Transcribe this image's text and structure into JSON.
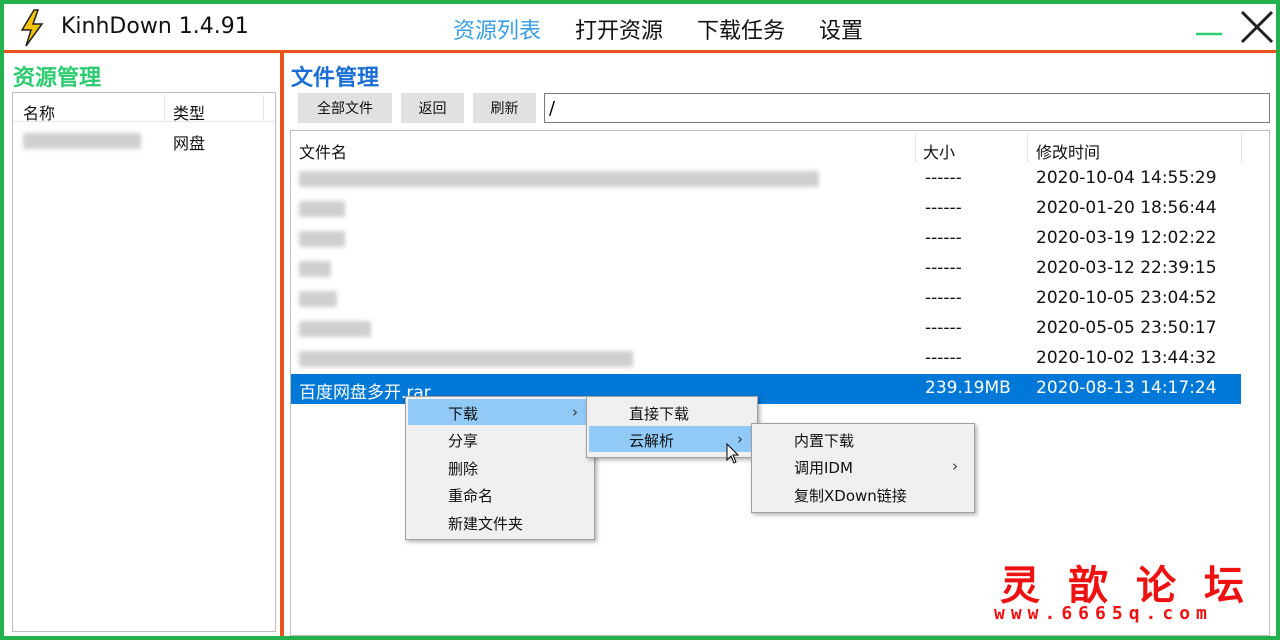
{
  "app": {
    "title": "KinhDown 1.4.91"
  },
  "nav": {
    "tabs": [
      {
        "label": "资源列表"
      },
      {
        "label": "打开资源"
      },
      {
        "label": "下载任务"
      },
      {
        "label": "设置"
      }
    ],
    "active_index": 0
  },
  "colors": {
    "frame": "#22b14c",
    "separator": "#e8541c",
    "left_title": "#2ecc71",
    "right_title": "#1a6fd4",
    "active_tab": "#3a9ee4",
    "selection": "#0078d7",
    "menu_highlight": "#91c9f7",
    "watermark": "#ee1111"
  },
  "left_panel": {
    "title": "资源管理",
    "columns": [
      "名称",
      "类型"
    ],
    "rows": [
      {
        "name": "",
        "type": "网盘"
      }
    ]
  },
  "right_panel": {
    "title": "文件管理",
    "toolbar": {
      "all_files": "全部文件",
      "back": "返回",
      "refresh": "刷新",
      "path": "/"
    },
    "columns": [
      "文件名",
      "大小",
      "修改时间"
    ],
    "files": [
      {
        "name": "",
        "size": "------",
        "time": "2020-10-04 14:55:29"
      },
      {
        "name": "",
        "size": "------",
        "time": "2020-01-20 18:56:44"
      },
      {
        "name": "",
        "size": "------",
        "time": "2020-03-19 12:02:22"
      },
      {
        "name": "",
        "size": "------",
        "time": "2020-03-12 22:39:15"
      },
      {
        "name": "",
        "size": "------",
        "time": "2020-10-05 23:04:52"
      },
      {
        "name": "",
        "size": "------",
        "time": "2020-05-05 23:50:17"
      },
      {
        "name": "",
        "size": "------",
        "time": "2020-10-02 13:44:32"
      },
      {
        "name": "百度网盘多开.rar",
        "size": "239.19MB",
        "time": "2020-08-13 14:17:24"
      }
    ]
  },
  "context_menu": {
    "main": [
      "下载",
      "分享",
      "删除",
      "重命名",
      "新建文件夹"
    ],
    "download_sub": [
      "直接下载",
      "云解析"
    ],
    "cloud_sub": [
      "内置下载",
      "调用IDM",
      "复制XDown链接"
    ],
    "arrow": "›"
  },
  "watermark": {
    "title": "灵歆论坛",
    "url": "www.6665q.com"
  }
}
